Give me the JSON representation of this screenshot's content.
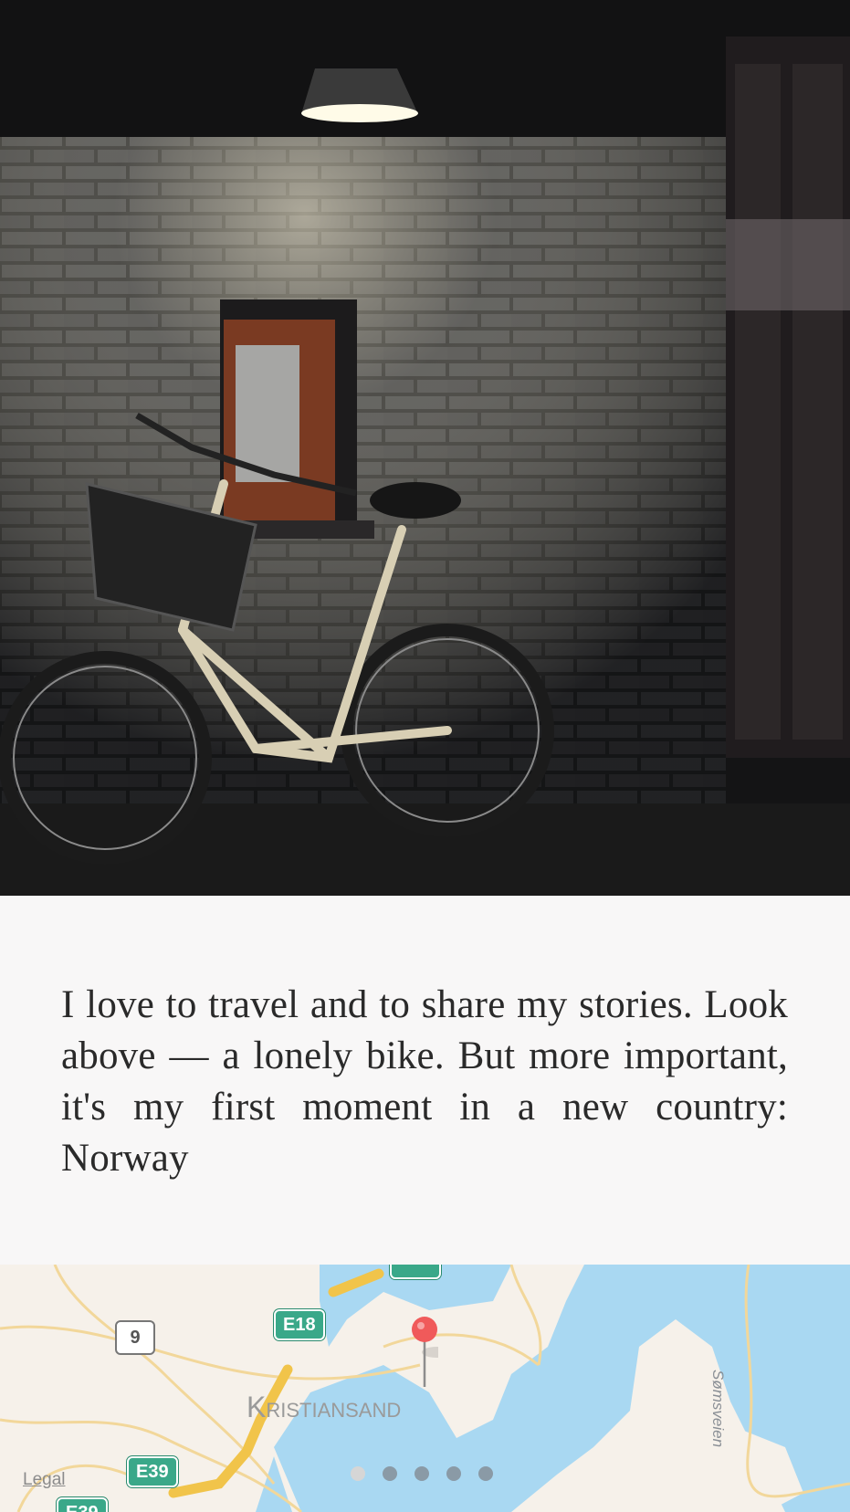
{
  "story": {
    "text": "I love to travel and to share my stories. Look above — a lonely bike. But more important, it's my first moment in a new country: Norway"
  },
  "map": {
    "city_label": "Kristiansand",
    "road_shields": {
      "e18": "E18",
      "e39": "E39",
      "e39_partial": "E39",
      "route9": "9"
    },
    "street_label": "Sømsveien",
    "legal_link": "Legal"
  },
  "pager": {
    "page_count": 5,
    "active_index": 0
  },
  "colors": {
    "background": "#f8f7f7",
    "text": "#2a2a2a",
    "water": "#a9d8f2",
    "highway_green": "#3aa889",
    "pin_red": "#f05a5a"
  }
}
